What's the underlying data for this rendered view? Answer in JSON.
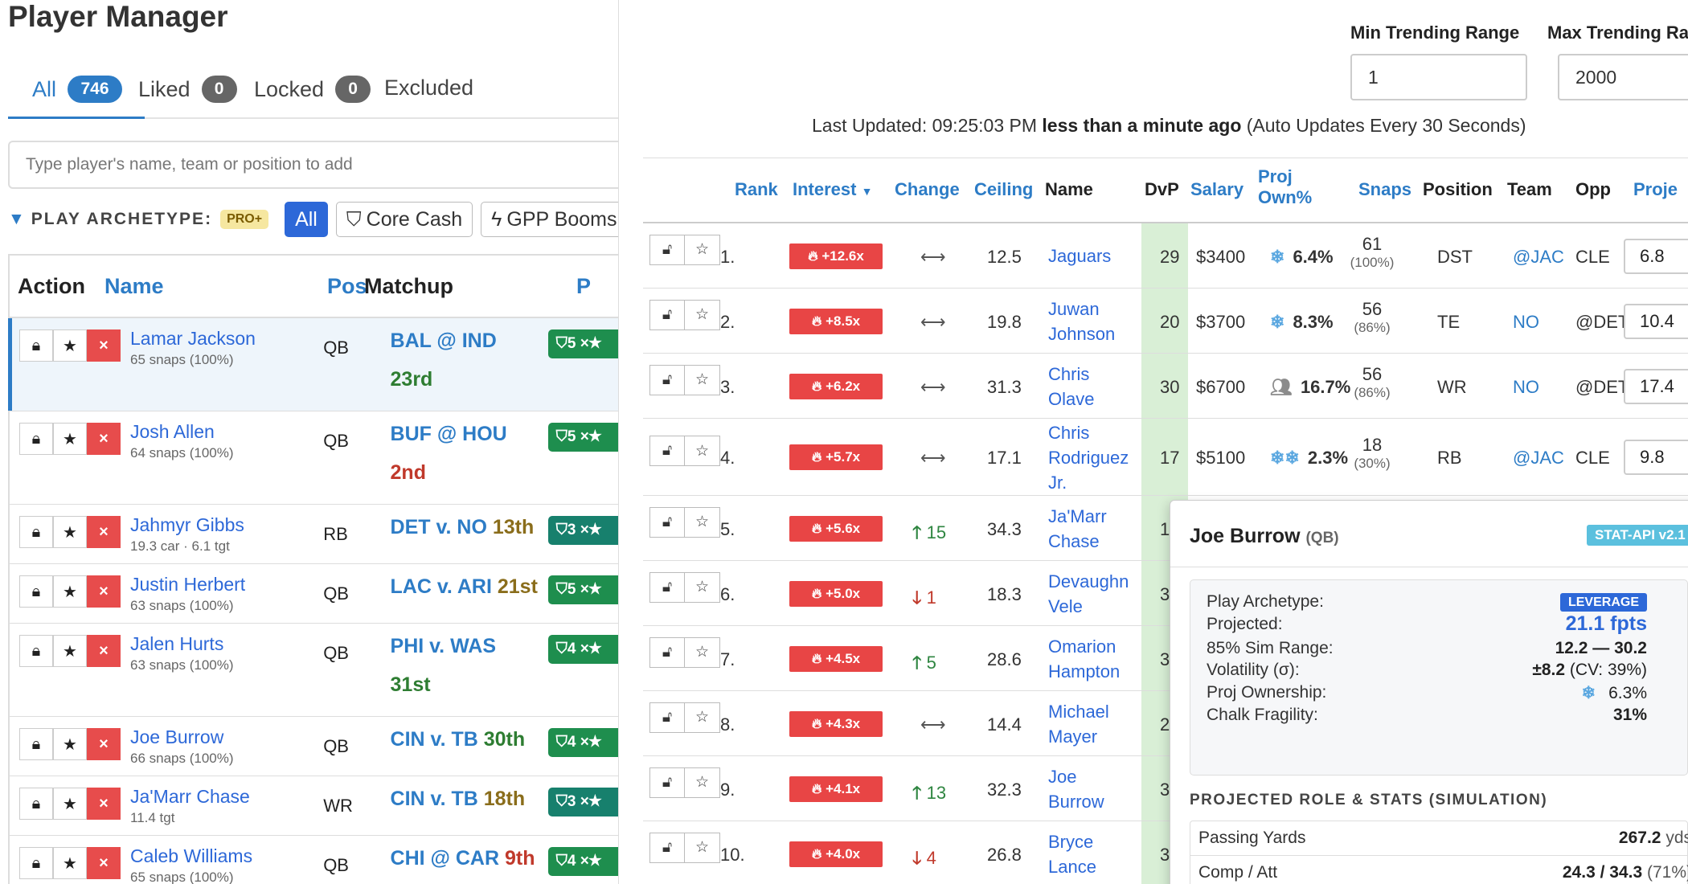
{
  "left": {
    "title": "Player Manager",
    "tabs": [
      {
        "label": "All",
        "count": "746"
      },
      {
        "label": "Liked",
        "count": "0"
      },
      {
        "label": "Locked",
        "count": "0"
      },
      {
        "label": "Excluded"
      }
    ],
    "search_placeholder": "Type player's name, team or position to add",
    "archetype": {
      "label": "PLAY ARCHETYPE:",
      "pro_badge": "PRO+",
      "buttons": [
        "All",
        "Core Cash",
        "GPP Booms"
      ]
    },
    "table_headers": {
      "action": "Action",
      "name": "Name",
      "pos": "Pos",
      "matchup": "Matchup",
      "extra": "P"
    },
    "players": [
      {
        "name": "Lamar Jackson",
        "sub": "65 snaps (100%)",
        "pos": "QB",
        "matchup": "BAL @ IND",
        "rank": "23rd",
        "tag": "5 ×"
      },
      {
        "name": "Josh Allen",
        "sub": "64 snaps (100%)",
        "pos": "QB",
        "matchup": "BUF @ HOU",
        "rank": "2nd",
        "tag": "5 ×"
      },
      {
        "name": "Jahmyr Gibbs",
        "sub": "19.3 car · 6.1 tgt",
        "pos": "RB",
        "matchup": "DET v. NO",
        "rank": "13th",
        "tag": "3 ×"
      },
      {
        "name": "Justin Herbert",
        "sub": "63 snaps (100%)",
        "pos": "QB",
        "matchup": "LAC v. ARI",
        "rank": "21st",
        "tag": "5 ×"
      },
      {
        "name": "Jalen Hurts",
        "sub": "63 snaps (100%)",
        "pos": "QB",
        "matchup": "PHI v. WAS",
        "rank": "31st",
        "tag": "4 ×"
      },
      {
        "name": "Joe Burrow",
        "sub": "66 snaps (100%)",
        "pos": "QB",
        "matchup": "CIN v. TB",
        "rank": "30th",
        "tag": "4 ×"
      },
      {
        "name": "Ja'Marr Chase",
        "sub": "11.4 tgt",
        "pos": "WR",
        "matchup": "CIN v. TB",
        "rank": "18th",
        "tag": "3 ×"
      },
      {
        "name": "Caleb Williams",
        "sub": "65 snaps (100%)",
        "pos": "QB",
        "matchup": "CHI @ CAR",
        "rank": "9th",
        "tag": "4 ×"
      }
    ]
  },
  "right": {
    "filters": {
      "min_label": "Min Trending Range",
      "min_value": "1",
      "max_label": "Max Trending Ra",
      "max_value": "2000"
    },
    "updated": {
      "prefix": "Last Updated: 09:25:03 PM",
      "bold": "less than a minute ago",
      "suffix": "(Auto Updates Every 30 Seconds)"
    },
    "headers": {
      "rank": "Rank",
      "interest": "Interest",
      "change": "Change",
      "ceiling": "Ceiling",
      "name": "Name",
      "dvp": "DvP",
      "salary": "Salary",
      "proj_own_1": "Proj",
      "proj_own_2": "Own%",
      "snaps": "Snaps",
      "position": "Position",
      "team": "Team",
      "opp": "Opp",
      "proj": "Proje"
    },
    "rows": [
      {
        "rank": "1.",
        "interest": "+12.6x",
        "change": "⟷",
        "ceiling": "12.5",
        "name1": "Jaguars",
        "name2": "",
        "name3": "",
        "dvp": "29",
        "salary": "$3400",
        "own": "6.4%",
        "own_icon": "snowflake-icon",
        "snaps": "61",
        "snaps_pct": "(100%)",
        "position": "DST",
        "team": "@JAC",
        "opp": "CLE",
        "proj": "6.8"
      },
      {
        "rank": "2.",
        "interest": "+8.5x",
        "change": "⟷",
        "ceiling": "19.8",
        "name1": "Juwan",
        "name2": "Johnson",
        "name3": "",
        "dvp": "20",
        "salary": "$3700",
        "own": "8.3%",
        "own_icon": "snowflake-icon",
        "snaps": "56",
        "snaps_pct": "(86%)",
        "position": "TE",
        "team": "NO",
        "opp": "@DET",
        "proj": "10.4"
      },
      {
        "rank": "3.",
        "interest": "+6.2x",
        "change": "⟷",
        "ceiling": "31.3",
        "name1": "Chris",
        "name2": "Olave",
        "name3": "",
        "dvp": "30",
        "salary": "$6700",
        "own": "16.7%",
        "own_icon": "group-icon",
        "snaps": "56",
        "snaps_pct": "(86%)",
        "position": "WR",
        "team": "NO",
        "opp": "@DET",
        "proj": "17.4"
      },
      {
        "rank": "4.",
        "interest": "+5.7x",
        "change": "⟷",
        "ceiling": "17.1",
        "name1": "Chris",
        "name2": "Rodriguez",
        "name3": "Jr.",
        "dvp": "17",
        "salary": "$5100",
        "own": "2.3%",
        "own_icon": "double-snowflake-icon",
        "snaps": "18",
        "snaps_pct": "(30%)",
        "position": "RB",
        "team": "@JAC",
        "opp": "CLE",
        "proj": "9.8"
      },
      {
        "rank": "5.",
        "interest": "+5.6x",
        "change": "15",
        "change_dir": "up",
        "ceiling": "34.3",
        "name1": "Ja'Marr",
        "name2": "Chase",
        "name3": "",
        "dvp": "1"
      },
      {
        "rank": "6.",
        "interest": "+5.0x",
        "change": "1",
        "change_dir": "down",
        "ceiling": "18.3",
        "name1": "Devaughn",
        "name2": "Vele",
        "name3": "",
        "dvp": "3"
      },
      {
        "rank": "7.",
        "interest": "+4.5x",
        "change": "5",
        "change_dir": "up",
        "ceiling": "28.6",
        "name1": "Omarion",
        "name2": "Hampton",
        "name3": "",
        "dvp": "3"
      },
      {
        "rank": "8.",
        "interest": "+4.3x",
        "change": "⟷",
        "ceiling": "14.4",
        "name1": "Michael",
        "name2": "Mayer",
        "name3": "",
        "dvp": "2"
      },
      {
        "rank": "9.",
        "interest": "+4.1x",
        "change": "13",
        "change_dir": "up",
        "ceiling": "32.3",
        "name1": "Joe",
        "name2": "Burrow",
        "name3": "",
        "dvp": "3"
      },
      {
        "rank": "10.",
        "interest": "+4.0x",
        "change": "4",
        "change_dir": "down",
        "ceiling": "26.8",
        "name1": "Bryce",
        "name2": "Lance",
        "name3": "",
        "dvp": "3"
      }
    ],
    "popover": {
      "name": "Joe Burrow",
      "pos": "(QB)",
      "api_tag": "STAT-API v2.1",
      "lines": [
        {
          "label": "Play Archetype:",
          "value": "LEVERAGE"
        },
        {
          "label": "Projected:",
          "value": "21.1 fpts"
        },
        {
          "label": "85% Sim Range:",
          "value": "12.2 — 30.2"
        },
        {
          "label": "Volatility (σ):",
          "value": "±8.2",
          "extra": "(CV: 39%)"
        },
        {
          "label": "Proj Ownership:",
          "value": "6.3%"
        },
        {
          "label": "Chalk Fragility:",
          "value": "31%"
        }
      ],
      "section_title": "PROJECTED ROLE & STATS (SIMULATION)",
      "stats": [
        {
          "label": "Passing Yards",
          "value": "267.2",
          "unit": "yds"
        },
        {
          "label": "Comp / Att",
          "value": "24.3 / 34.3",
          "unit": "(71%)"
        }
      ]
    }
  }
}
